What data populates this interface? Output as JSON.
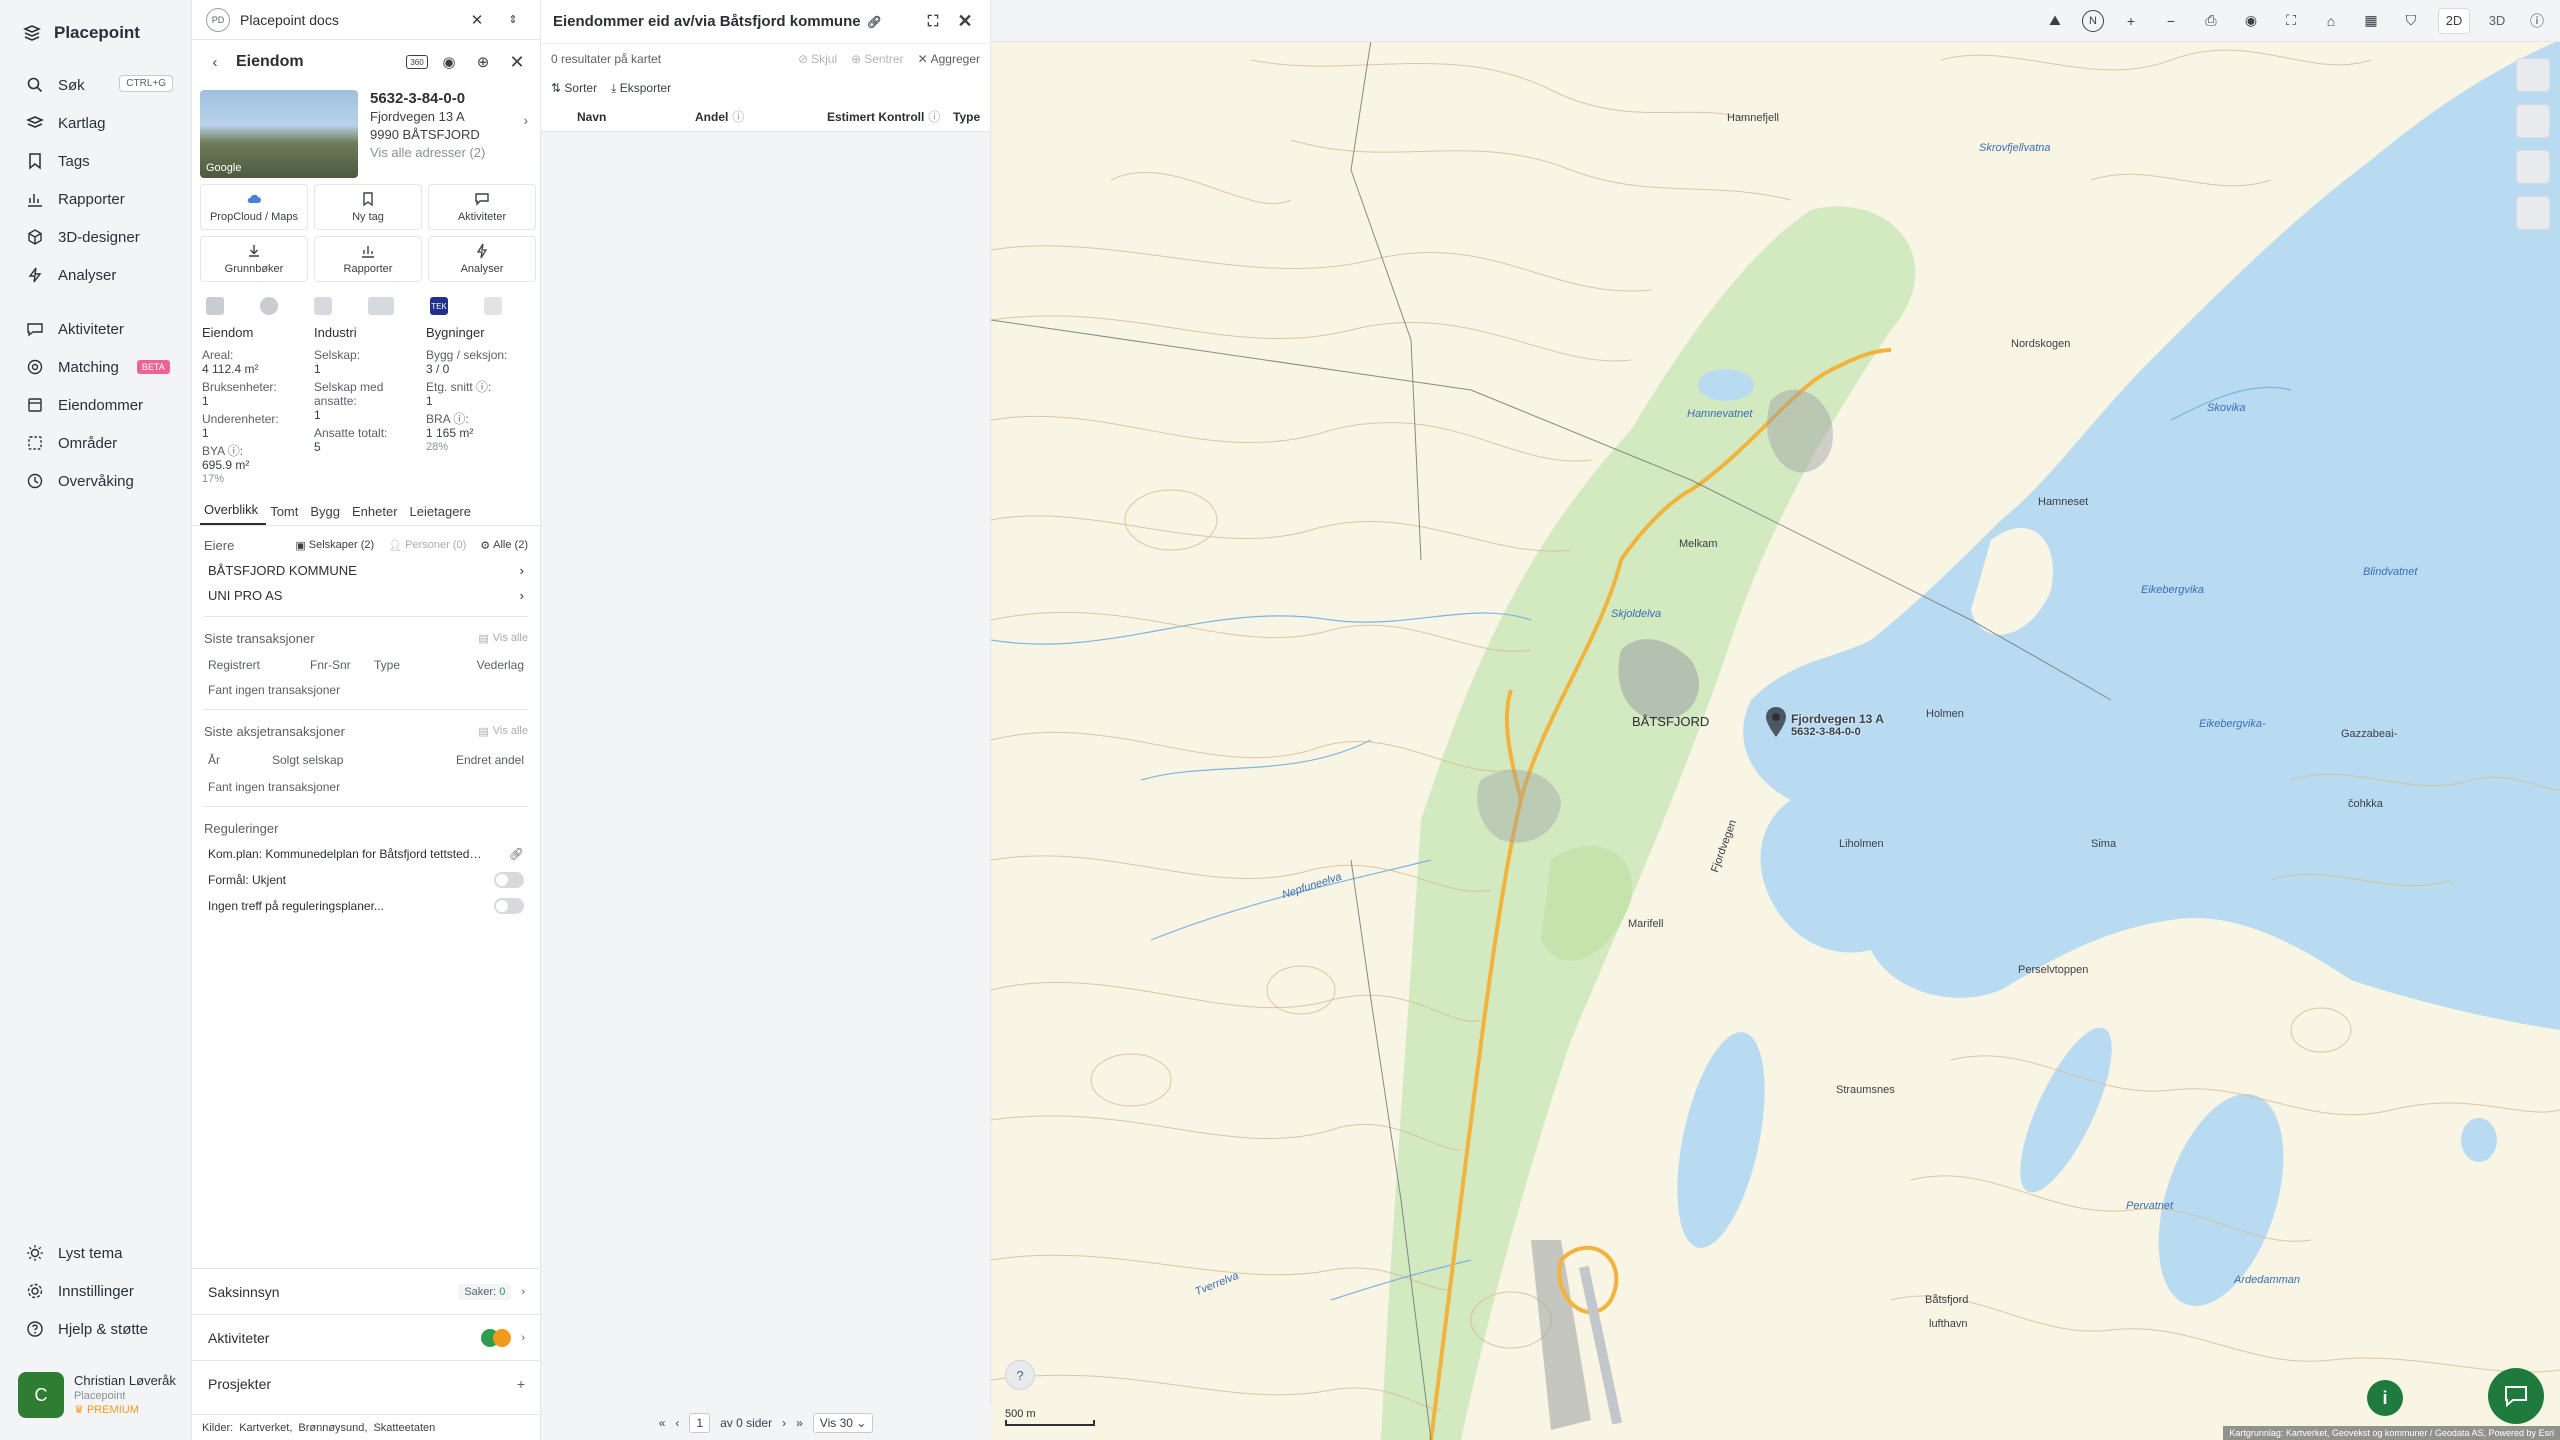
{
  "app": {
    "name": "Placepoint"
  },
  "nav": {
    "search": {
      "label": "Søk",
      "shortcut": "CTRL+G"
    },
    "items": [
      {
        "label": "Kartlag"
      },
      {
        "label": "Tags"
      },
      {
        "label": "Rapporter"
      },
      {
        "label": "3D-designer"
      },
      {
        "label": "Analyser"
      }
    ],
    "items2": [
      {
        "label": "Aktiviteter"
      },
      {
        "label": "Matching",
        "badge": "BETA"
      },
      {
        "label": "Eiendommer"
      },
      {
        "label": "Områder"
      },
      {
        "label": "Overvåking"
      }
    ],
    "bottom": [
      {
        "label": "Lyst tema"
      },
      {
        "label": "Innstillinger"
      },
      {
        "label": "Hjelp & støtte"
      }
    ],
    "user": {
      "initial": "C",
      "name": "Christian Løveråk",
      "org": "Placepoint",
      "plan": "PREMIUM"
    }
  },
  "workspace": {
    "badge": "PD",
    "name": "Placepoint docs"
  },
  "property": {
    "header": "Eiendom",
    "badge_360": "360",
    "thumb_label": "Google",
    "id": "5632-3-84-0-0",
    "street": "Fjordvegen 13 A",
    "postal": "9990 BÅTSFJORD",
    "addresses_link": "Vis alle adresser (2)",
    "tiles": [
      {
        "label": "PropCloud / Maps",
        "icon": "cloud-icon"
      },
      {
        "label": "Ny tag",
        "icon": "bookmark-icon"
      },
      {
        "label": "Aktiviteter",
        "icon": "chat-icon"
      },
      {
        "label": "Grunnbøker",
        "icon": "download-icon"
      },
      {
        "label": "Rapporter",
        "icon": "chart-icon"
      },
      {
        "label": "Analyser",
        "icon": "bolt-icon"
      }
    ],
    "tek_label": "TEK",
    "stats": {
      "eiendom": {
        "head": "Eiendom",
        "areal_l": "Areal:",
        "areal_v": "4 112.4 m²",
        "bruk_l": "Bruksenheter:",
        "bruk_v": "1",
        "under_l": "Underenheter:",
        "under_v": "1",
        "bya_l": "BYA ⓘ:",
        "bya_v": "695.9 m²",
        "bya_p": "17%"
      },
      "industri": {
        "head": "Industri",
        "selskap_l": "Selskap:",
        "selskap_v": "1",
        "ansatte_l": "Selskap med ansatte:",
        "ansatte_v": "1",
        "tot_l": "Ansatte totalt:",
        "tot_v": "5"
      },
      "bygninger": {
        "head": "Bygninger",
        "bygg_l": "Bygg / seksjon:",
        "bygg_v": "3 / 0",
        "etg_l": "Etg. snitt ⓘ:",
        "etg_v": "1",
        "bra_l": "BRA ⓘ:",
        "bra_v": "1 165 m²",
        "bra_p": "28%"
      }
    },
    "tabs": [
      "Overblikk",
      "Tomt",
      "Bygg",
      "Enheter",
      "Leietagere"
    ],
    "owners": {
      "label": "Eiere",
      "chip_companies": "Selskaper (2)",
      "chip_persons": "Personer (0)",
      "chip_all": "Alle (2)",
      "list": [
        "BÅTSFJORD KOMMUNE",
        "UNI PRO AS"
      ]
    },
    "transactions": {
      "label": "Siste transaksjoner",
      "show_all": "Vis alle",
      "cols": [
        "Registrert",
        "Fnr-Snr",
        "Type",
        "Vederlag"
      ],
      "empty": "Fant ingen transaksjoner"
    },
    "share_transactions": {
      "label": "Siste aksjetransaksjoner",
      "show_all": "Vis alle",
      "cols": [
        "År",
        "Solgt selskap",
        "Endret andel"
      ],
      "empty": "Fant ingen transaksjoner"
    },
    "regulations": {
      "label": "Reguleringer",
      "plan": "Kom.plan: Kommunedelplan for Båtsfjord tettsted…",
      "formal": "Formål: Ukjent",
      "none": "Ingen treff på reguleringsplaner..."
    },
    "accordions": [
      {
        "label": "Saksinnsyn",
        "meta": "Saker:",
        "count": "0"
      },
      {
        "label": "Aktiviteter"
      },
      {
        "label": "Prosjekter"
      }
    ],
    "sources": {
      "label": "Kilder:",
      "items": [
        "Kartverket,",
        "Brønnøysund,",
        "Skatteetaten"
      ]
    }
  },
  "owned": {
    "title": "Eiendommer eid av/via Båtsfjord kommune",
    "results": "0 resultater på kartet",
    "hide": "Skjul",
    "center": "Sentrer",
    "aggregate": "Aggreger",
    "sort": "Sorter",
    "export": "Eksporter",
    "cols": [
      "Navn",
      "Andel",
      "Estimert Kontroll",
      "Type"
    ],
    "pager": {
      "page": "1",
      "of": "av 0 sider",
      "show": "Vis 30"
    }
  },
  "map": {
    "toolbar": {
      "north": "N",
      "zoom_in": "+",
      "zoom_out": "−",
      "mode_2d": "2D",
      "mode_3d": "3D"
    },
    "labels": [
      "Hamnefjell",
      "Skrovfjellvatna",
      "Nordskogen",
      "Skovika",
      "Hamnevatnet",
      "Hamneset",
      "Melkam",
      "Eikebergvika",
      "Blindvatnet",
      "Skjoldelva",
      "BÅTSFJORD",
      "Holmen",
      "Eikebergvika-",
      "Gazzabeai-",
      "Liholmen",
      "Sima",
      "čohkka",
      "Marifell",
      "Perselvtoppen",
      "Straumsnes",
      "Pervatnet",
      "Båtsfjord",
      "lufthavn",
      "Fjordvegen",
      "Ardedamman",
      "Tverrelva",
      "Nepfuneelva"
    ],
    "marker": "Fjordvegen 13 A",
    "marker_id": "5632-3-84-0-0",
    "scale": "500 m",
    "attribution": "Kartgrunnlag: Kartverket, Geovekst og kommuner / Geodata AS, Powered by Esri",
    "help": "?",
    "info": "i",
    "colors": {
      "water": "#b9dbf2",
      "land": "#f8f5e4",
      "forest": "#cde8b8",
      "contour": "#d9b98a",
      "road": "#f2b33d"
    }
  }
}
